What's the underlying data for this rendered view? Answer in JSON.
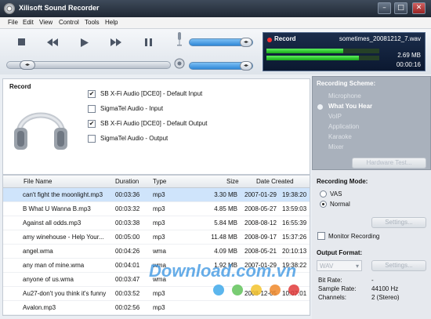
{
  "window": {
    "title": "Xilisoft Sound Recorder",
    "minimize": "–",
    "maximize": "□",
    "close": "✕"
  },
  "menu": [
    "File",
    "Edit",
    "View",
    "Control",
    "Tools",
    "Help"
  ],
  "display": {
    "status": "Record",
    "filename": "sometimes_20081212_7.wav",
    "size": "2.69 MB",
    "time": "00:00:16",
    "levels": [
      0.68,
      0.82
    ]
  },
  "record": {
    "title": "Record",
    "sources": [
      {
        "label": "SB X-Fi Audio [DCE0] - Default Input",
        "checked": true
      },
      {
        "label": "SigmaTel Audio - Input",
        "checked": false
      },
      {
        "label": "SB X-Fi Audio [DCE0] - Default Output",
        "checked": true
      },
      {
        "label": "SigmaTel Audio - Output",
        "checked": false
      }
    ]
  },
  "table": {
    "headers": [
      "File Name",
      "Duration",
      "Type",
      "Size",
      "Date Created"
    ],
    "rows": [
      [
        "can't fight the moonlight.mp3",
        "00:03:36",
        "mp3",
        "3.30 MB",
        "2007-01-29",
        "19:38:20"
      ],
      [
        "B What U Wanna B.mp3",
        "00:03:32",
        "mp3",
        "4.85 MB",
        "2008-05-27",
        "13:59:03"
      ],
      [
        "Against all odds.mp3",
        "00:03:38",
        "mp3",
        "5.84 MB",
        "2008-08-12",
        "16:55:39"
      ],
      [
        "amy winehouse - Help Your...",
        "00:05:00",
        "mp3",
        "11.48 MB",
        "2008-09-17",
        "15:37:26"
      ],
      [
        "angel.wma",
        "00:04:26",
        "wma",
        "4.09 MB",
        "2008-05-21",
        "20:10:13"
      ],
      [
        "any man of mine.wma",
        "00:04:01",
        "wma",
        "1.92 MB",
        "2007-01-29",
        "19:38:22"
      ],
      [
        "anyone of us.wma",
        "00:03:47",
        "wma",
        "",
        "",
        ""
      ],
      [
        "Au27-don't you think it's funny",
        "00:03:52",
        "mp3",
        "",
        "2008-12-05",
        "10:07:01"
      ],
      [
        "Avalon.mp3",
        "00:02:56",
        "mp3",
        "",
        "",
        ""
      ]
    ]
  },
  "scheme": {
    "title": "Recording Scheme:",
    "items": [
      "Microphone",
      "What You Hear",
      "VoIP",
      "Application",
      "Karaoke",
      "Mixer"
    ],
    "active": "What You Hear",
    "hardware_button": "Hardware Test..."
  },
  "mode": {
    "title": "Recording Mode:",
    "options": [
      "VAS",
      "Normal"
    ],
    "selected": "Normal",
    "settings_button": "Settings...",
    "monitor_label": "Monitor Recording"
  },
  "output": {
    "title": "Output Format:",
    "format": "WAV",
    "settings_button": "Settings...",
    "props": [
      {
        "label": "Bit Rate:",
        "value": "-"
      },
      {
        "label": "Sample Rate:",
        "value": "44100 Hz"
      },
      {
        "label": "Channels:",
        "value": "2 (Stereo)"
      }
    ]
  },
  "watermark": {
    "text": "Download.com.vn",
    "colors": [
      "#3fa9ea",
      "#62c35a",
      "#f3c32d",
      "#f08a2b",
      "#e23b3b"
    ]
  }
}
